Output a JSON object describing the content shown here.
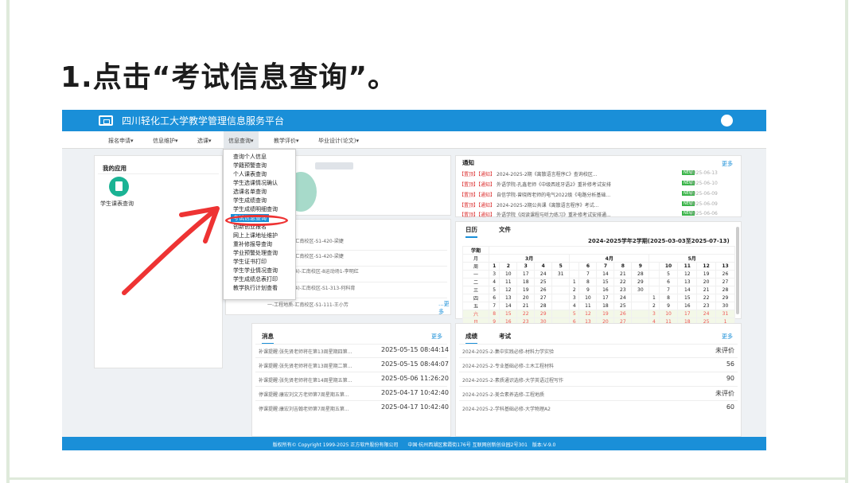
{
  "heading": "1.点击“考试信息查询”。",
  "platform_title": "四川轻化工大学教学管理信息服务平台",
  "nav": [
    "报名申请▾",
    "信息维护▾",
    "选课▾",
    "信息查询▾",
    "教学评价▾",
    "毕业设计(论文)▾"
  ],
  "my_apps": {
    "title": "我的应用",
    "app": "学生课表查询"
  },
  "dropdown": [
    "查询个人信息",
    "学籍预警查询",
    "个人课表查询",
    "学生选课情况确认",
    "选课名单查询",
    "学生成绩查询",
    "学生成绩明细查询",
    "考试信息查询",
    "创新创业报名",
    "网上上课地址维护",
    "重补修报导查询",
    "学业预警处理查询",
    "学生证书打印",
    "学生学业情况查询",
    "学生成绩总表打印",
    "教学执行计划查看"
  ],
  "courses": [
    "期四-水力学-汇南校区-S1-420-梁婕",
    "期一-水力学-汇南校区-S1-420-梁婕",
    "星期二-体育(4)-汇南校区-8运动场1-李明红",
    "星期二-外语(4)-汇南校区-S1-313-何科育",
    "一-工程地质-汇南校区-S1-111-王小芳"
  ],
  "more": "更多",
  "more2": "...更多",
  "notice": {
    "title": "通知",
    "items": [
      {
        "tag": "【置顶】",
        "type": "【通知】",
        "text": "2024-2025-2期《离散语言程序C》查询校区...",
        "date": "2025-06-13"
      },
      {
        "tag": "【置顶】",
        "type": "【通知】",
        "text": "外语学院-孔鑫老师《中级西班牙语2》重补修考试安排",
        "date": "2025-06-10"
      },
      {
        "tag": "【置顶】",
        "type": "【通知】",
        "text": "自信学院-曾晓辉老师的电气2022级《电路分析基础...",
        "date": "2025-06-09"
      },
      {
        "tag": "【置顶】",
        "type": "【通知】",
        "text": "2024-2025-2期公共课《离散语言程序》考试...",
        "date": "2025-06-09"
      },
      {
        "tag": "【置顶】",
        "type": "【通知】",
        "text": "外语学院《阅读课程与听力练习》重补修考试安排通...",
        "date": "2025-06-06"
      }
    ],
    "new_label": "NEW"
  },
  "calendar": {
    "tabs": [
      "日历",
      "文件"
    ],
    "term": "2024-2025学年2学期(2025-03-03至2025-07-13)",
    "corner": [
      "学期",
      "月",
      "周",
      "星期"
    ],
    "months": [
      "3月",
      "4月",
      "5月"
    ],
    "weeks": [
      "1",
      "2",
      "3",
      "4",
      "5",
      "6",
      "7",
      "8",
      "9",
      "10",
      "11",
      "12",
      "13"
    ],
    "rows": [
      {
        "day": "一",
        "cells": [
          "3",
          "10",
          "17",
          "24",
          "31",
          "",
          "7",
          "14",
          "21",
          "28",
          "",
          "5",
          "12",
          "19",
          "26"
        ]
      },
      {
        "day": "二",
        "cells": [
          "4",
          "11",
          "18",
          "25",
          "",
          "1",
          "8",
          "15",
          "22",
          "29",
          "",
          "6",
          "13",
          "20",
          "27"
        ]
      },
      {
        "day": "三",
        "cells": [
          "5",
          "12",
          "19",
          "26",
          "",
          "2",
          "9",
          "16",
          "23",
          "30",
          "",
          "7",
          "14",
          "21",
          "28"
        ]
      },
      {
        "day": "四",
        "cells": [
          "6",
          "13",
          "20",
          "27",
          "",
          "3",
          "10",
          "17",
          "24",
          "",
          "1",
          "8",
          "15",
          "22",
          "29"
        ]
      },
      {
        "day": "五",
        "cells": [
          "7",
          "14",
          "21",
          "28",
          "",
          "4",
          "11",
          "18",
          "25",
          "",
          "2",
          "9",
          "16",
          "23",
          "30"
        ]
      },
      {
        "day": "六",
        "cells": [
          "8",
          "15",
          "22",
          "29",
          "",
          "5",
          "12",
          "19",
          "26",
          "",
          "3",
          "10",
          "17",
          "24",
          "31"
        ]
      },
      {
        "day": "日",
        "cells": [
          "9",
          "16",
          "23",
          "30",
          "",
          "6",
          "13",
          "20",
          "27",
          "",
          "4",
          "11",
          "18",
          "25",
          "1"
        ]
      }
    ]
  },
  "messages": {
    "tab": "消息",
    "items": [
      {
        "text": "补课提醒:张先贤老师将在第13周星期四第...",
        "date": "2025-05-15 08:44:14"
      },
      {
        "text": "补课提醒:张先贤老师将在第13周星期二第...",
        "date": "2025-05-15 08:44:07"
      },
      {
        "text": "补课提醒:张先贤老师将在第14周星期五第...",
        "date": "2025-05-06 11:26:20"
      },
      {
        "text": "停课提醒:康宏刘文方老师第7周星期五第...",
        "date": "2025-04-17 10:42:40"
      },
      {
        "text": "停课提醒:康宏刘吉翰老师第7周星期五第...",
        "date": "2025-04-17 10:42:40"
      }
    ]
  },
  "grades": {
    "tabs": [
      "成绩",
      "考试"
    ],
    "items": [
      {
        "course": "2024-2025-2-集中实践必修-材料力学实验",
        "value": "未评价"
      },
      {
        "course": "2024-2025-2-专业基础必修-土木工程材料",
        "value": "56"
      },
      {
        "course": "2024-2025-2-素质通识选修-大学英语过程写作",
        "value": "90"
      },
      {
        "course": "2024-2025-2-美合素养选修-工程地质",
        "value": "未评价"
      },
      {
        "course": "2024-2025-2-学科基础必修-大学物理A2",
        "value": "60"
      }
    ]
  },
  "footer": "版权所有© Copyright 1999-2025 正方软件股份有限公司　　中国·杭州西湖区紫霞街176号 互联网创新创业园2号301　版本:V-9.0",
  "colors": {
    "brand": "#1a8fd8",
    "annotation": "#e33333",
    "new_badge": "#3bb54a"
  }
}
